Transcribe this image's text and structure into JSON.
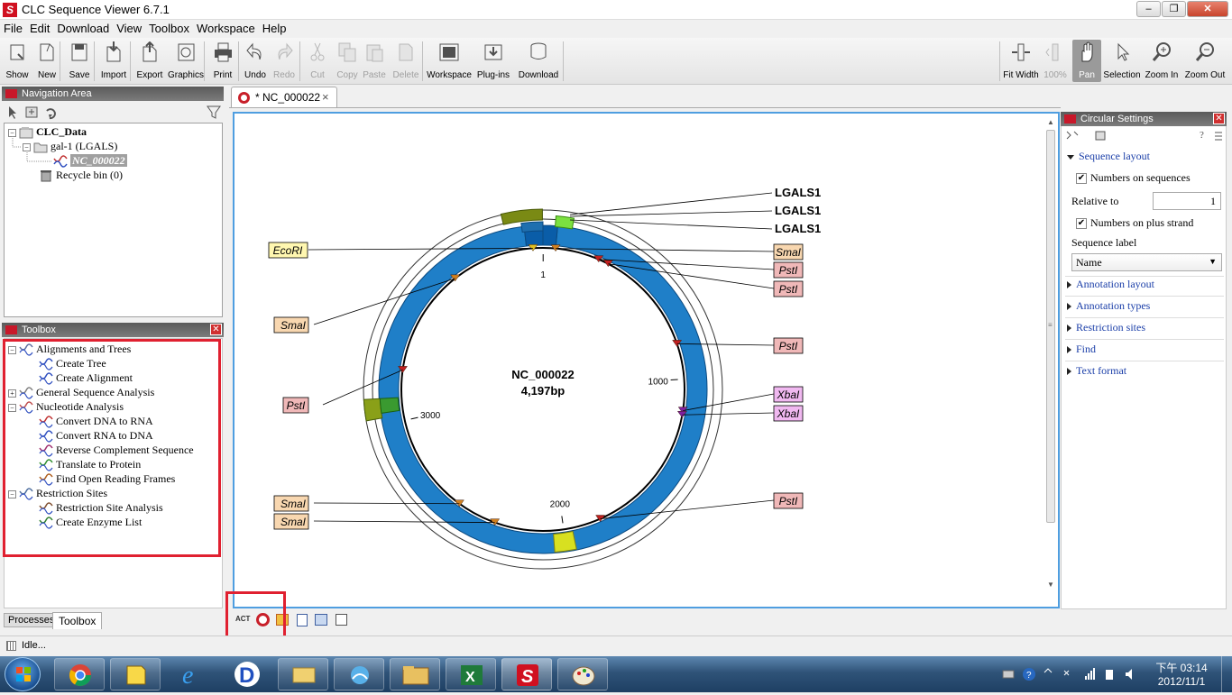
{
  "window": {
    "title": "CLC Sequence Viewer 6.7.1",
    "logo": "S"
  },
  "menu": [
    "File",
    "Edit",
    "Download",
    "View",
    "Toolbox",
    "Workspace",
    "Help"
  ],
  "toolbar": {
    "left": [
      {
        "label": "Show",
        "icon": "show-icon",
        "enabled": true
      },
      {
        "label": "New",
        "icon": "new-icon",
        "enabled": true
      },
      {
        "label": "Save",
        "icon": "save-icon",
        "enabled": true
      },
      {
        "label": "Import",
        "icon": "import-icon",
        "enabled": true
      },
      {
        "label": "Export",
        "icon": "export-icon",
        "enabled": true
      },
      {
        "label": "Graphics",
        "icon": "graphics-icon",
        "enabled": true
      },
      {
        "label": "Print",
        "icon": "print-icon",
        "enabled": true
      },
      {
        "label": "Undo",
        "icon": "undo-icon",
        "enabled": true
      },
      {
        "label": "Redo",
        "icon": "redo-icon",
        "enabled": false
      },
      {
        "label": "Cut",
        "icon": "cut-icon",
        "enabled": false
      },
      {
        "label": "Copy",
        "icon": "copy-icon",
        "enabled": false
      },
      {
        "label": "Paste",
        "icon": "paste-icon",
        "enabled": false
      },
      {
        "label": "Delete",
        "icon": "delete-icon",
        "enabled": false
      },
      {
        "label": "Workspace",
        "icon": "workspace-icon",
        "enabled": true
      },
      {
        "label": "Plug-ins",
        "icon": "plugins-icon",
        "enabled": true
      },
      {
        "label": "Download",
        "icon": "download-icon",
        "enabled": true
      }
    ],
    "right": [
      {
        "label": "Fit Width",
        "icon": "fit-width-icon",
        "enabled": true
      },
      {
        "label": "100%",
        "icon": "zoom-100-icon",
        "enabled": false
      },
      {
        "label": "Pan",
        "icon": "pan-icon",
        "enabled": true,
        "active": true
      },
      {
        "label": "Selection",
        "icon": "selection-icon",
        "enabled": true
      },
      {
        "label": "Zoom In",
        "icon": "zoom-in-icon",
        "enabled": true
      },
      {
        "label": "Zoom Out",
        "icon": "zoom-out-icon",
        "enabled": true
      }
    ]
  },
  "navigation": {
    "title": "Navigation Area",
    "items": [
      {
        "label": "CLC_Data"
      },
      {
        "label": "gal-1 (LGALS)"
      },
      {
        "label": "NC_000022"
      },
      {
        "label": "Recycle bin (0)"
      }
    ]
  },
  "toolbox": {
    "title": "Toolbox",
    "items": [
      {
        "label": "Alignments and Trees"
      },
      {
        "label": "Create Tree"
      },
      {
        "label": "Create Alignment"
      },
      {
        "label": "General Sequence Analysis"
      },
      {
        "label": "Nucleotide Analysis"
      },
      {
        "label": "Convert DNA to RNA"
      },
      {
        "label": "Convert RNA to DNA"
      },
      {
        "label": "Reverse Complement Sequence"
      },
      {
        "label": "Translate to Protein"
      },
      {
        "label": "Find Open Reading Frames"
      },
      {
        "label": "Restriction Sites"
      },
      {
        "label": "Restriction Site Analysis"
      },
      {
        "label": "Create Enzyme List"
      }
    ],
    "bottom_tabs": [
      "Processes",
      "Toolbox"
    ]
  },
  "editor": {
    "tab_label": "* NC_000022",
    "tab_close": "×",
    "sequence_name": "NC_000022",
    "length_label": "4,197bp",
    "view_icons": [
      "text-view-icon",
      "circular-view-icon",
      "graphical-view-icon",
      "table-view-icon",
      "history-icon",
      "annotation-table-icon"
    ],
    "view_badge": "ACT"
  },
  "map": {
    "total_bp": 4197,
    "ticks": [
      {
        "pos": 1,
        "label": "1"
      },
      {
        "pos": 1000,
        "label": "1000"
      },
      {
        "pos": 2000,
        "label": "2000"
      },
      {
        "pos": 3000,
        "label": "3000"
      }
    ],
    "annotations": [
      {
        "label": "LGALS1",
        "start": 40,
        "end": 100,
        "color": "#8db43c",
        "ring": "outer"
      },
      {
        "label": "LGALS1",
        "start": 4040,
        "end": 4197,
        "color": "#7a8a14",
        "ring": "outer"
      },
      {
        "label": "LGALS1",
        "start": 70,
        "end": 110,
        "color": "#a8e04a",
        "ring": "outer"
      }
    ],
    "mrna": {
      "color": "#1f7fc8",
      "label": "LGALS1"
    },
    "enzymes": [
      {
        "name": "EcoRI",
        "color": "#fff7b0"
      },
      {
        "name": "SmaI",
        "color": "#f8d7b0"
      },
      {
        "name": "PstI",
        "color": "#f0b8b8"
      },
      {
        "name": "PstI",
        "color": "#f0b8b8"
      },
      {
        "name": "SmaI",
        "color": "#f8d7b0"
      },
      {
        "name": "PstI",
        "color": "#f0b8b8"
      },
      {
        "name": "PstI",
        "color": "#f0b8b8"
      },
      {
        "name": "XbaI",
        "color": "#f0b8f0"
      },
      {
        "name": "XbaI",
        "color": "#f0b8f0"
      },
      {
        "name": "SmaI",
        "color": "#f8d7b0"
      },
      {
        "name": "SmaI",
        "color": "#f8d7b0"
      },
      {
        "name": "PstI",
        "color": "#f0b8b8"
      }
    ],
    "gene_labels": [
      "LGALS1",
      "LGALS1",
      "LGALS1"
    ]
  },
  "settings": {
    "title": "Circular Settings",
    "help": "?",
    "sections": {
      "sequence_layout": "Sequence layout",
      "numbers_on_sequences": "Numbers on sequences",
      "relative_to": "Relative to",
      "relative_to_value": "1",
      "numbers_on_plus_strand": "Numbers on plus strand",
      "sequence_label": "Sequence label",
      "sequence_label_value": "Name",
      "annotation_layout": "Annotation layout",
      "annotation_types": "Annotation types",
      "restriction_sites": "Restriction sites",
      "find": "Find",
      "text_format": "Text format"
    }
  },
  "status": {
    "text": "Idle..."
  },
  "taskbar": {
    "apps": [
      "chrome-icon",
      "sticky-icon",
      "ie-icon",
      "d-app-icon",
      "folder-app-icon",
      "sync-icon",
      "explorer-icon",
      "excel-icon",
      "clc-icon",
      "paint-icon"
    ],
    "time": "下午 03:14",
    "date": "2012/11/1"
  }
}
